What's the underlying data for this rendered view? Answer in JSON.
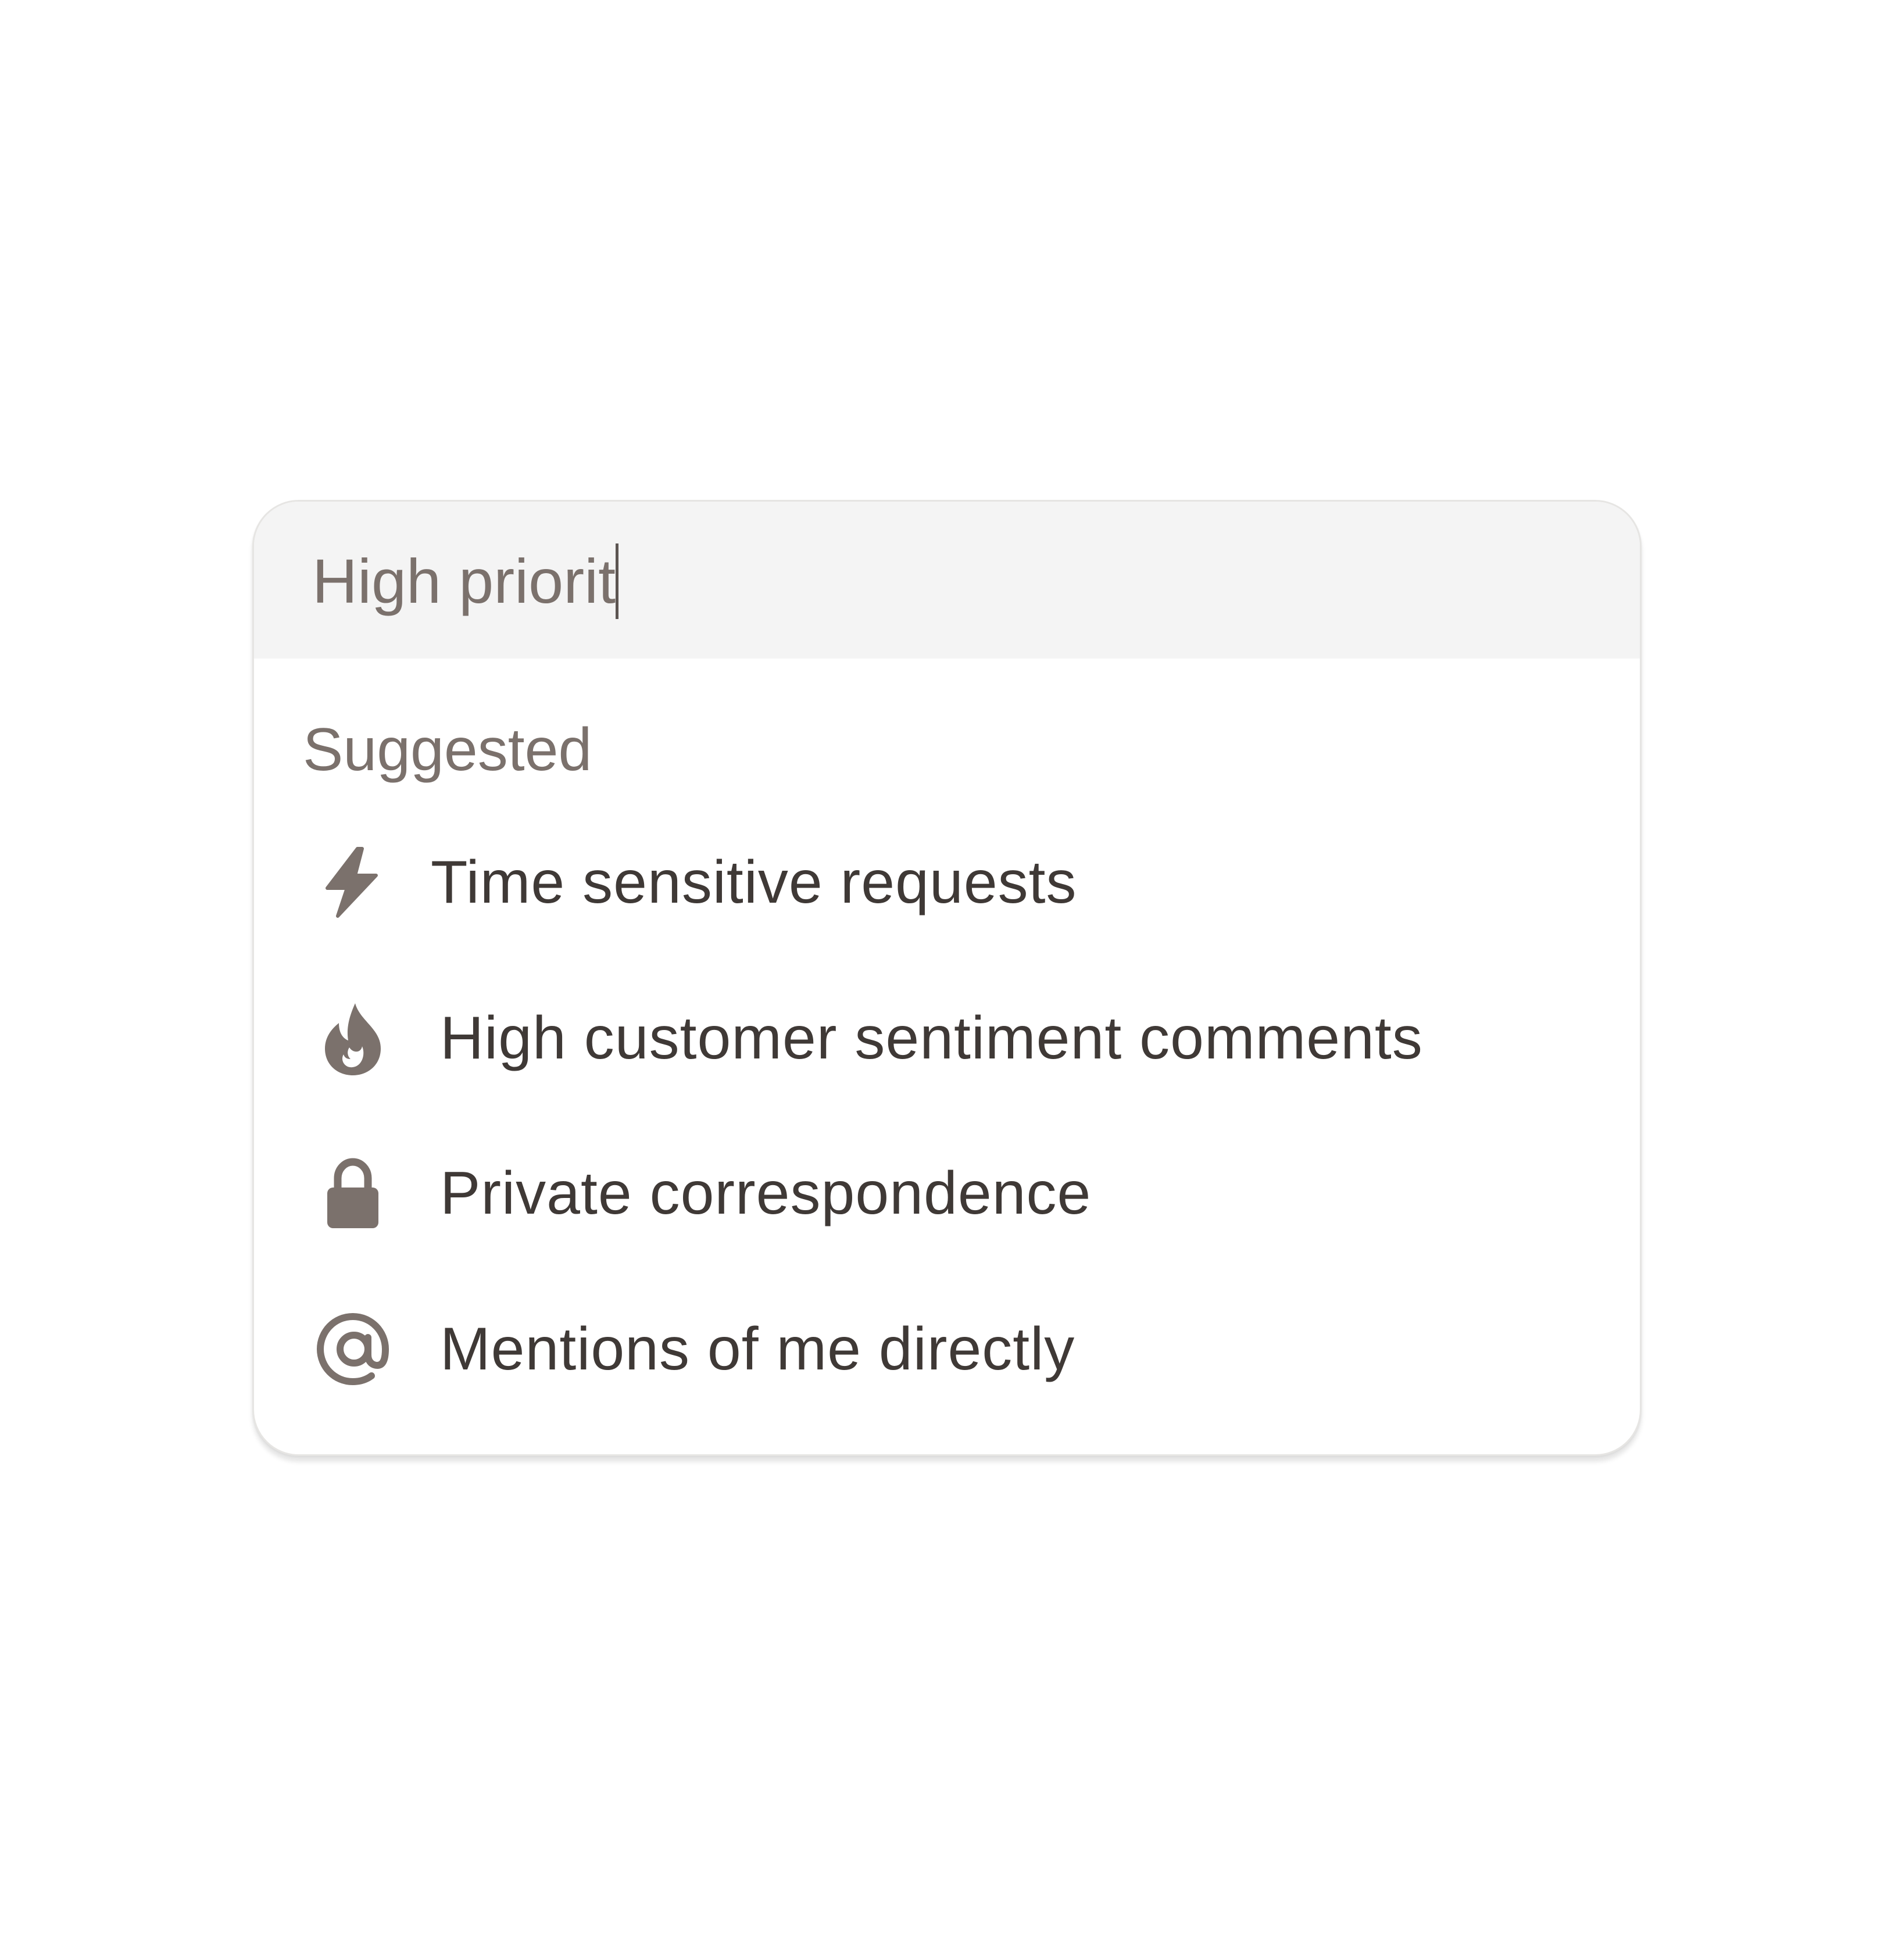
{
  "search": {
    "value": "High priorit"
  },
  "suggestions": {
    "header": "Suggested",
    "items": [
      {
        "icon": "lightning-icon",
        "label": "Time sensitive requests"
      },
      {
        "icon": "fire-icon",
        "label": "High customer sentiment comments"
      },
      {
        "icon": "lock-icon",
        "label": "Private correspondence"
      },
      {
        "icon": "at-sign-icon",
        "label": "Mentions of me directly"
      }
    ]
  },
  "colors": {
    "icon": "#7b716c",
    "text": "#3f3936",
    "muted_text": "#7b716c",
    "search_bg": "#f4f4f4",
    "card_border": "#e6e5e3"
  }
}
